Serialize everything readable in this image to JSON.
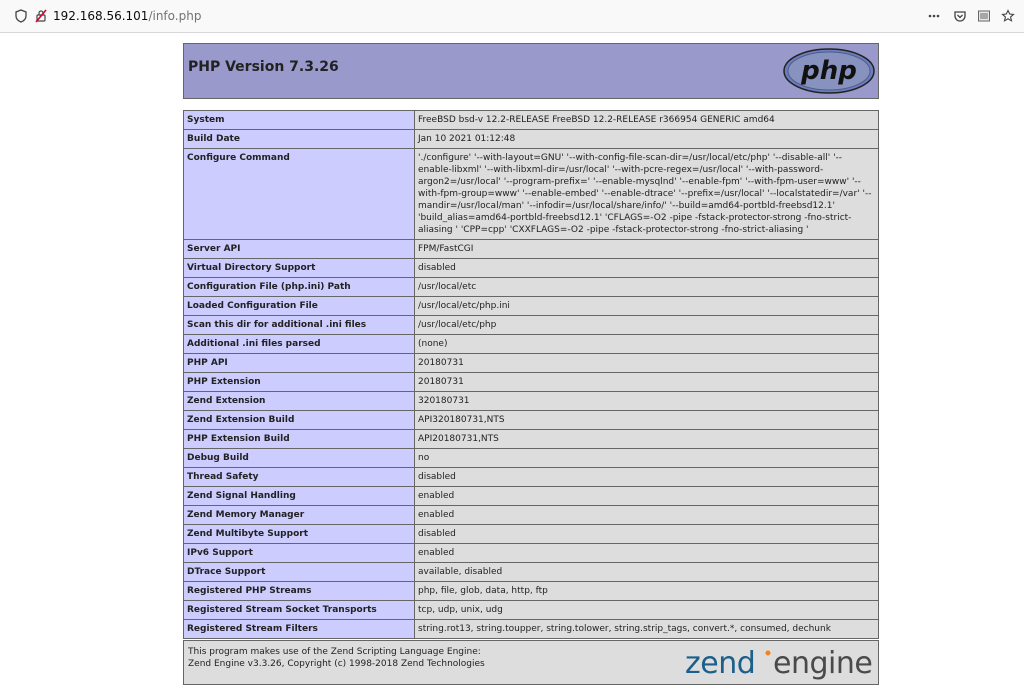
{
  "browser": {
    "url_host": "192.168.56.101",
    "url_path": "/info.php"
  },
  "header": {
    "title": "PHP Version 7.3.26",
    "logo_text": "php"
  },
  "rows": [
    {
      "key": "System",
      "value": "FreeBSD bsd-v 12.2-RELEASE FreeBSD 12.2-RELEASE r366954 GENERIC amd64"
    },
    {
      "key": "Build Date",
      "value": "Jan 10 2021 01:12:48"
    },
    {
      "key": "Configure Command",
      "value": "'./configure' '--with-layout=GNU' '--with-config-file-scan-dir=/usr/local/etc/php' '--disable-all' '--enable-libxml' '--with-libxml-dir=/usr/local' '--with-pcre-regex=/usr/local' '--with-password-argon2=/usr/local' '--program-prefix=' '--enable-mysqlnd' '--enable-fpm' '--with-fpm-user=www' '--with-fpm-group=www' '--enable-embed' '--enable-dtrace' '--prefix=/usr/local' '--localstatedir=/var' '--mandir=/usr/local/man' '--infodir=/usr/local/share/info/' '--build=amd64-portbld-freebsd12.1' 'build_alias=amd64-portbld-freebsd12.1' 'CFLAGS=-O2 -pipe -fstack-protector-strong -fno-strict-aliasing ' 'CPP=cpp' 'CXXFLAGS=-O2 -pipe -fstack-protector-strong -fno-strict-aliasing '"
    },
    {
      "key": "Server API",
      "value": "FPM/FastCGI"
    },
    {
      "key": "Virtual Directory Support",
      "value": "disabled"
    },
    {
      "key": "Configuration File (php.ini) Path",
      "value": "/usr/local/etc"
    },
    {
      "key": "Loaded Configuration File",
      "value": "/usr/local/etc/php.ini"
    },
    {
      "key": "Scan this dir for additional .ini files",
      "value": "/usr/local/etc/php"
    },
    {
      "key": "Additional .ini files parsed",
      "value": "(none)"
    },
    {
      "key": "PHP API",
      "value": "20180731"
    },
    {
      "key": "PHP Extension",
      "value": "20180731"
    },
    {
      "key": "Zend Extension",
      "value": "320180731"
    },
    {
      "key": "Zend Extension Build",
      "value": "API320180731,NTS"
    },
    {
      "key": "PHP Extension Build",
      "value": "API20180731,NTS"
    },
    {
      "key": "Debug Build",
      "value": "no"
    },
    {
      "key": "Thread Safety",
      "value": "disabled"
    },
    {
      "key": "Zend Signal Handling",
      "value": "enabled"
    },
    {
      "key": "Zend Memory Manager",
      "value": "enabled"
    },
    {
      "key": "Zend Multibyte Support",
      "value": "disabled"
    },
    {
      "key": "IPv6 Support",
      "value": "enabled"
    },
    {
      "key": "DTrace Support",
      "value": "available, disabled"
    },
    {
      "key": "Registered PHP Streams",
      "value": "php, file, glob, data, http, ftp"
    },
    {
      "key": "Registered Stream Socket Transports",
      "value": "tcp, udp, unix, udg"
    },
    {
      "key": "Registered Stream Filters",
      "value": "string.rot13, string.toupper, string.tolower, string.strip_tags, convert.*, consumed, dechunk"
    }
  ],
  "footer": {
    "line1": "This program makes use of the Zend Scripting Language Engine:",
    "line2": "Zend Engine v3.3.26, Copyright (c) 1998-2018 Zend Technologies",
    "logo_text_zend": "zend",
    "logo_text_engine": "engine"
  },
  "icons": {
    "shield": "shield-icon",
    "insecure_lock": "insecure-lock-icon",
    "page_actions": "page-actions-icon",
    "pocket": "pocket-icon",
    "reader": "reader-view-icon",
    "bookmark": "bookmark-star-icon"
  },
  "colors": {
    "header_bg": "#9999cc",
    "key_bg": "#ccccff",
    "value_bg": "#dddddd",
    "border": "#666666"
  }
}
